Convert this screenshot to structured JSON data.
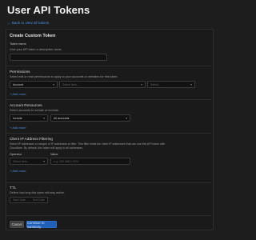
{
  "page": {
    "title": "User API Tokens",
    "back_link": "← Back to view all tokens"
  },
  "form": {
    "heading": "Create Custom Token",
    "token_name": {
      "label": "Token name",
      "description": "Give your API token a descriptive name.",
      "value": ""
    },
    "permissions": {
      "label": "Permissions",
      "description": "Select edit or read permissions to apply to your accounts or websites for this token.",
      "scope_select": "Account",
      "item_select_placeholder": "Select item...",
      "access_select_placeholder": "Select...",
      "add_more": "+ Add more"
    },
    "account_resources": {
      "label": "Account Resources",
      "description": "Select accounts to include or exclude.",
      "include_select": "Include",
      "accounts_select": "All accounts",
      "add_more": "+ Add more"
    },
    "ip_filtering": {
      "label": "Client IP Address Filtering",
      "description_line1": "Select IP addresses or ranges of IP addresses to filter. This filter limits the client IP addresses that can use this API token with",
      "description_line2": "Cloudflare. By default, this token will apply to all addresses.",
      "operator_label": "Operator",
      "value_label": "Value",
      "operator_placeholder": "Select item...",
      "value_placeholder": "e.g. 192.168.1.0/24",
      "add_more": "+ Add more"
    },
    "ttl": {
      "label": "TTL",
      "description": "Define how long this token will stay active.",
      "start_date": "Start Date",
      "arrow": "→",
      "end_date": "End Date"
    },
    "buttons": {
      "cancel": "Cancel",
      "continue": "Continue to summary"
    }
  },
  "colors": {
    "background": "#1d1d1d",
    "card": "#1a1a1a",
    "link": "#4a8fe0",
    "primary_button": "#1f5fb8"
  }
}
